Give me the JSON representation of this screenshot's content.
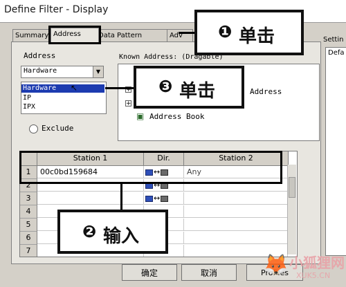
{
  "window": {
    "title": "Define Filter - Display"
  },
  "tabs": [
    {
      "label": "Summary"
    },
    {
      "label": "Address"
    },
    {
      "label": "Data Pattern"
    },
    {
      "label": "Adv"
    }
  ],
  "address_panel": {
    "label": "Address",
    "combo_value": "Hardware",
    "options": [
      "Hardware",
      "IP",
      "IPX"
    ],
    "highlighted_option": "Hardware",
    "exclude_label": "Exclude"
  },
  "known_address": {
    "label": "Known Address: (Dragable)",
    "items": [
      "Address",
      "Address Book"
    ]
  },
  "grid": {
    "columns": [
      "Station 1",
      "Dir.",
      "Station 2"
    ],
    "rows": [
      {
        "num": "1",
        "station1": "00c0bd159684",
        "dir": "↔",
        "station2": "Any"
      },
      {
        "num": "2",
        "station1": "",
        "dir": "↔",
        "station2": ""
      },
      {
        "num": "3",
        "station1": "",
        "dir": "↔",
        "station2": ""
      },
      {
        "num": "4",
        "station1": "",
        "dir": "",
        "station2": ""
      },
      {
        "num": "5",
        "station1": "",
        "dir": "",
        "station2": ""
      },
      {
        "num": "6",
        "station1": "",
        "dir": "",
        "station2": ""
      },
      {
        "num": "7",
        "station1": "",
        "dir": "",
        "station2": ""
      }
    ]
  },
  "right_panel": {
    "label": "Settin",
    "item": "Defa"
  },
  "buttons": {
    "ok": "确定",
    "cancel": "取消",
    "profiles": "Profiles"
  },
  "callouts": [
    {
      "marker": "❶",
      "text": "单击"
    },
    {
      "marker": "❸",
      "text": "单击"
    },
    {
      "marker": "❷",
      "text": "输入"
    }
  ],
  "watermark": {
    "text": "小狐狸网",
    "sub": "XUK5.CN"
  },
  "colors": {
    "selection": "#1c3bb0",
    "callout_border": "#111111"
  }
}
